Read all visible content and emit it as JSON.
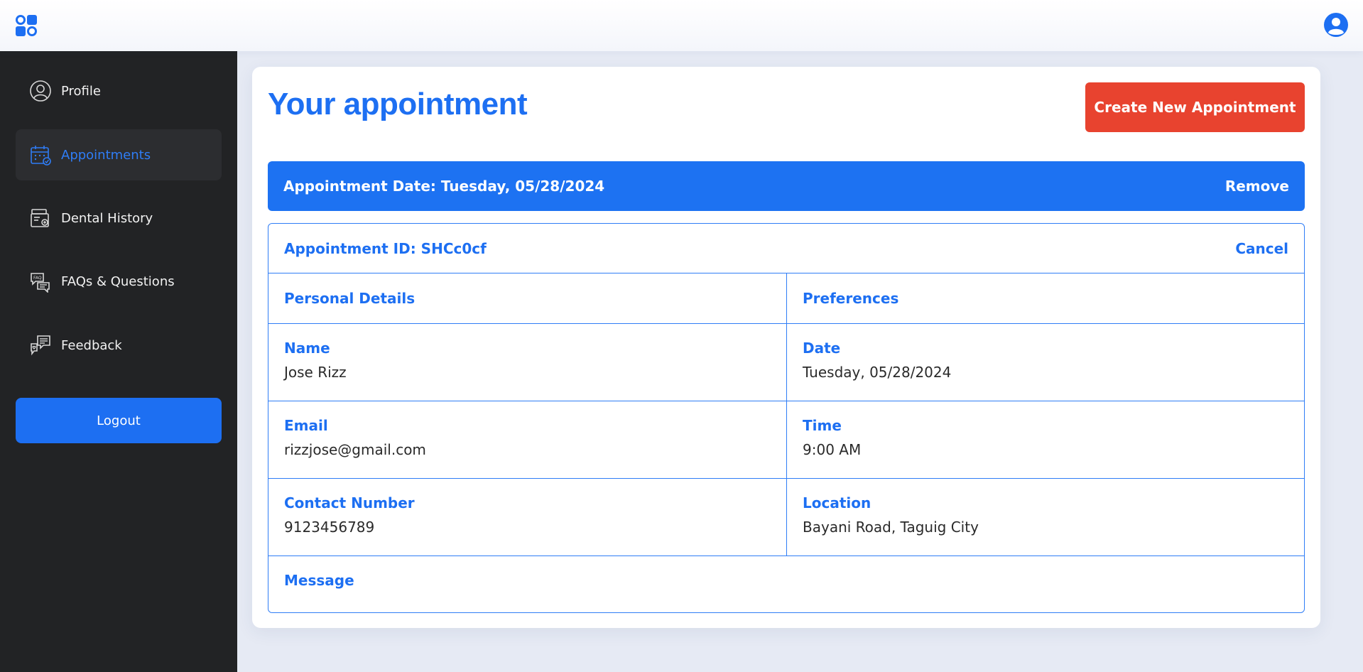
{
  "header": {
    "logo_icon": "app-logo-icon",
    "user_icon": "user-avatar-icon"
  },
  "sidebar": {
    "items": [
      {
        "label": "Profile",
        "icon": "profile-icon"
      },
      {
        "label": "Appointments",
        "icon": "calendar-icon",
        "active": true
      },
      {
        "label": "Dental History",
        "icon": "dental-history-icon"
      },
      {
        "label": "FAQs & Questions",
        "icon": "faq-icon"
      },
      {
        "label": "Feedback",
        "icon": "feedback-icon"
      }
    ],
    "logout_label": "Logout"
  },
  "main": {
    "title": "Your appointment",
    "create_button": "Create New Appointment",
    "appointment_date": "Appointment Date: Tuesday, 05/28/2024",
    "remove_label": "Remove",
    "appointment_id": "Appointment ID: SHCc0cf",
    "cancel_label": "Cancel",
    "personal_details_header": "Personal Details",
    "preferences_header": "Preferences",
    "fields": {
      "name_label": "Name",
      "name_value": "Jose Rizz",
      "email_label": "Email",
      "email_value": "rizzjose@gmail.com",
      "contact_label": "Contact Number",
      "contact_value": "9123456789",
      "date_label": "Date",
      "date_value": "Tuesday, 05/28/2024",
      "time_label": "Time",
      "time_value": "9:00 AM",
      "location_label": "Location",
      "location_value": "Bayani Road, Taguig City",
      "message_label": "Message"
    }
  },
  "colors": {
    "accent": "#1d6ff2",
    "danger": "#e8432f",
    "sidebar_bg": "#222325",
    "page_bg": "#e6eaf4"
  }
}
